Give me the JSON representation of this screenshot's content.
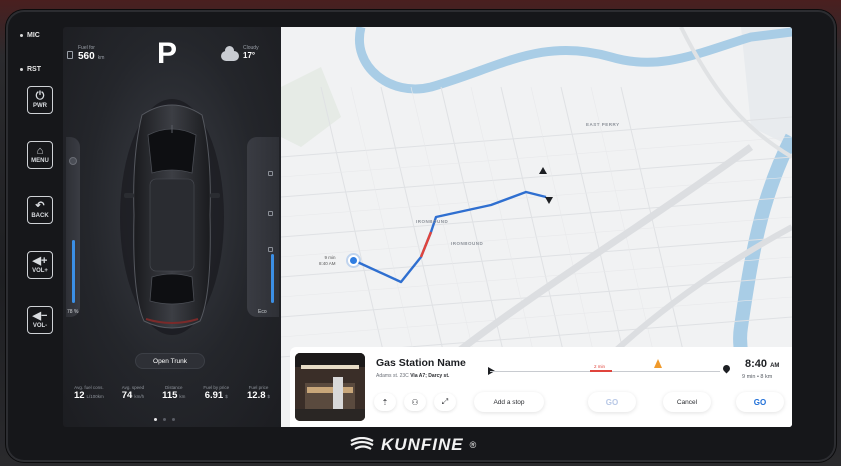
{
  "hardware": {
    "mic_label": "MIC",
    "rst_label": "RST",
    "buttons": [
      {
        "label": "PWR",
        "icon": "power-icon"
      },
      {
        "label": "MENU",
        "icon": "home-icon"
      },
      {
        "label": "BACK",
        "icon": "back-icon"
      },
      {
        "label": "VOL+",
        "icon": "volume-up-icon"
      },
      {
        "label": "VOL-",
        "icon": "volume-down-icon"
      }
    ]
  },
  "car_panel": {
    "fuel_caption": "Fuel for",
    "fuel_value": "560",
    "fuel_unit": "km",
    "gear": "P",
    "weather_caption": "Cloudy",
    "weather_temp": "17°",
    "left_slider_label": "78 %",
    "right_slider_label": "Eco",
    "left_slider_level": 0.45,
    "right_slider_level": 0.35,
    "open_trunk_label": "Open Trunk",
    "stats": [
      {
        "caption": "Avg. fuel cons.",
        "value": "12",
        "unit": "L/100km"
      },
      {
        "caption": "Avg. speed",
        "value": "74",
        "unit": "km/h"
      },
      {
        "caption": "Distance",
        "value": "115",
        "unit": "km"
      },
      {
        "caption": "Fuel by price",
        "value": "6.91",
        "unit": "$"
      },
      {
        "caption": "Fuel price",
        "value": "12.8",
        "unit": "$"
      }
    ],
    "page_count": 3,
    "active_page": 1
  },
  "map": {
    "labels": [
      "EAST PERRY",
      "IRONBOUND",
      "IRONBOUND"
    ],
    "eta_tag_line1": "9 min",
    "eta_tag_line2": "8:40 AM"
  },
  "nav_card": {
    "destination": "Gas Station Name",
    "address_prefix": "Adams st. 23C",
    "address_route": "Via A7; Darcy st.",
    "progress_label": "2 min",
    "arrival_time": "8:40",
    "arrival_ampm": "AM",
    "arrival_sub": "9 min • 8 km",
    "add_stop_label": "Add a stop",
    "go_ghost_label": "GO",
    "cancel_label": "Cancel",
    "go_label": "GO"
  },
  "brand": {
    "name": "KUNFINE",
    "reg": "®"
  },
  "colors": {
    "route_blue": "#2f6fd0",
    "route_red": "#e0443c",
    "slider_blue": "#3b8fe5",
    "river": "#a9cde6",
    "accent_go": "#1f6fd8"
  }
}
